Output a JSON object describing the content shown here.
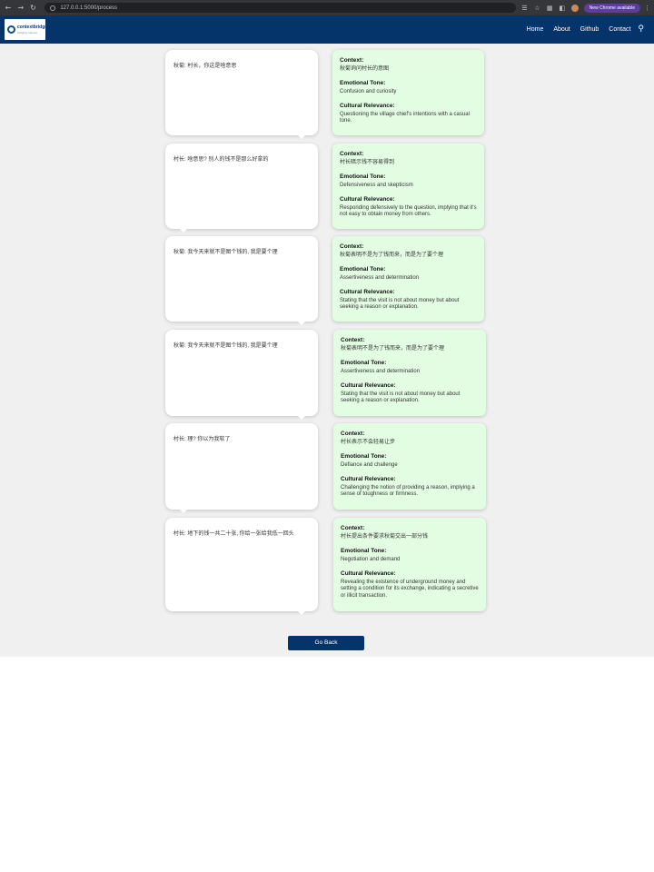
{
  "browser": {
    "url": "127.0.0.1:5000/process",
    "chrome_badge": "New Chrome available"
  },
  "navbar": {
    "logo_text": "contextbridge",
    "logo_sub": "bridging cultures",
    "links": [
      "Home",
      "About",
      "Github",
      "Contact"
    ]
  },
  "labels": {
    "context": "Context:",
    "tone": "Emotional Tone:",
    "relevance": "Cultural Relevance:"
  },
  "rows": [
    {
      "dialogue": "秋菊: 村长，你这是啥意思",
      "context": "秋菊询问村长的意图",
      "tone": "Confusion and curiosity",
      "relevance": "Questioning the village chief's intentions with a casual tone."
    },
    {
      "dialogue": "村长: 啥意思? 别人的钱不是那么好拿的",
      "context": "村长暗示钱不容易得到",
      "tone": "Defensiveness and skepticism",
      "relevance": "Responding defensively to the question, implying that it's not easy to obtain money from others."
    },
    {
      "dialogue": "秋菊: 我今天来就不是图个钱的, 我是要个理",
      "context": "秋菊表明不是为了钱而来，而是为了要个理",
      "tone": "Assertiveness and determination",
      "relevance": "Stating that the visit is not about money but about seeking a reason or explanation."
    },
    {
      "dialogue": "秋菊: 我今天来就不是图个钱的, 我是要个理",
      "context": "秋菊表明不是为了钱而来，而是为了要个理",
      "tone": "Assertiveness and determination",
      "relevance": "Stating that the visit is not about money but about seeking a reason or explanation."
    },
    {
      "dialogue": "村长: 理? 你以为我软了",
      "context": "村长表示不会轻易让步",
      "tone": "Defiance and challenge",
      "relevance": "Challenging the notion of providing a reason, implying a sense of toughness or firmness."
    },
    {
      "dialogue": "村长: 地下的钱一共二十张, 你给一张给我低一回头",
      "context": "村长提出条件要求秋菊交出一部分钱",
      "tone": "Negotiation and demand",
      "relevance": "Revealing the existence of underground money and setting a condition for its exchange, indicating a secretive or illicit transaction."
    }
  ],
  "go_back_label": "Go Back"
}
